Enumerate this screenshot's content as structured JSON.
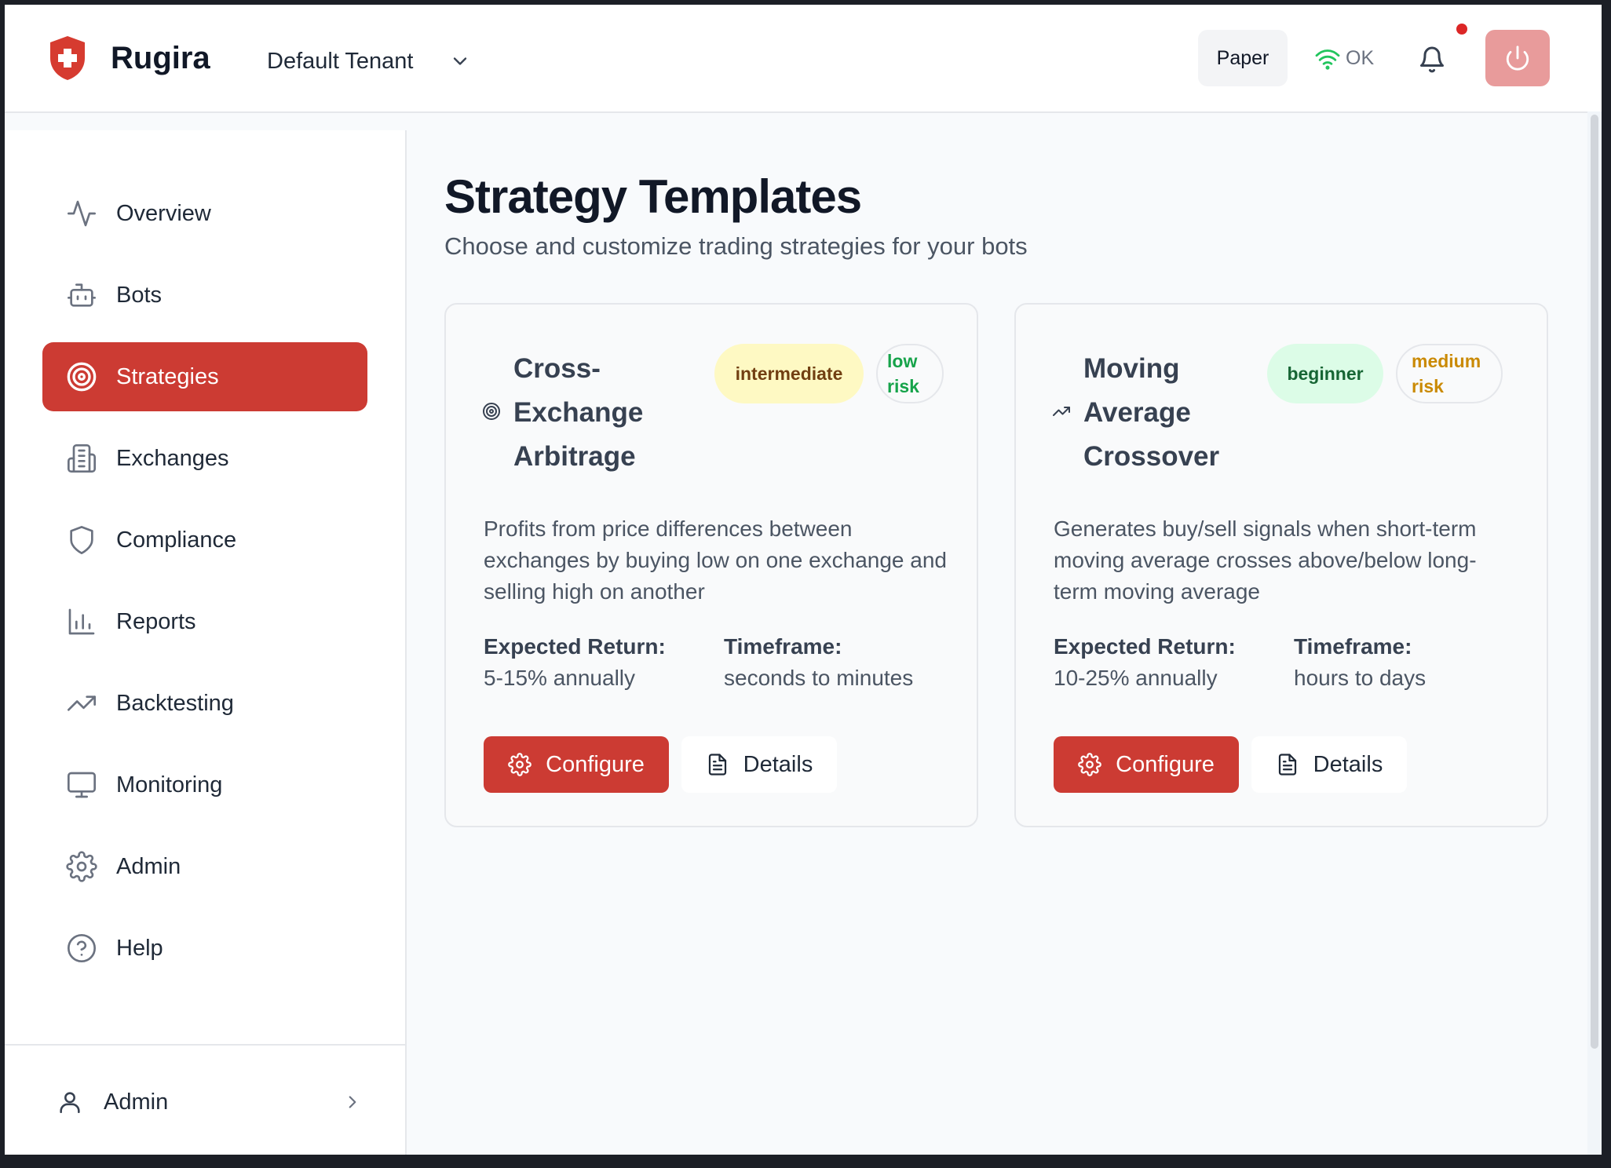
{
  "header": {
    "brand": "Rugira",
    "tenant": "Default Tenant",
    "mode": "Paper",
    "connection_status": "OK"
  },
  "sidebar": {
    "items": [
      {
        "label": "Overview",
        "icon": "activity-icon"
      },
      {
        "label": "Bots",
        "icon": "bot-icon"
      },
      {
        "label": "Strategies",
        "icon": "target-icon",
        "active": true
      },
      {
        "label": "Exchanges",
        "icon": "building-icon"
      },
      {
        "label": "Compliance",
        "icon": "shield-icon"
      },
      {
        "label": "Reports",
        "icon": "bar-chart-icon"
      },
      {
        "label": "Backtesting",
        "icon": "trending-up-icon"
      },
      {
        "label": "Monitoring",
        "icon": "monitor-icon"
      },
      {
        "label": "Admin",
        "icon": "gear-icon"
      },
      {
        "label": "Help",
        "icon": "help-circle-icon"
      }
    ],
    "user": "Admin"
  },
  "main": {
    "title": "Strategy Templates",
    "subtitle": "Choose and customize trading strategies for your bots",
    "cards": [
      {
        "title": "Cross-Exchange Arbitrage",
        "icon": "target-icon",
        "level": "intermediate",
        "risk": "low risk",
        "description": "Profits from price differences between exchanges by buying low on one exchange and selling high on another",
        "expected_return_label": "Expected Return:",
        "expected_return": "5-15% annually",
        "timeframe_label": "Timeframe:",
        "timeframe": "seconds to minutes",
        "configure_label": "Configure",
        "details_label": "Details"
      },
      {
        "title": "Moving Average Crossover",
        "icon": "trending-up-icon",
        "level": "beginner",
        "risk": "medium risk",
        "description": "Generates buy/sell signals when short-term moving average crosses above/below long-term moving average",
        "expected_return_label": "Expected Return:",
        "expected_return": "10-25% annually",
        "timeframe_label": "Timeframe:",
        "timeframe": "hours to days",
        "configure_label": "Configure",
        "details_label": "Details"
      }
    ]
  },
  "colors": {
    "accent": "#cc3b33",
    "intermediate_bg": "#fef9c3",
    "intermediate_text": "#713f12",
    "beginner_bg": "#dcfce7",
    "beginner_text": "#166534",
    "low_risk_text": "#16a34a",
    "medium_risk_text": "#ca8a04"
  }
}
